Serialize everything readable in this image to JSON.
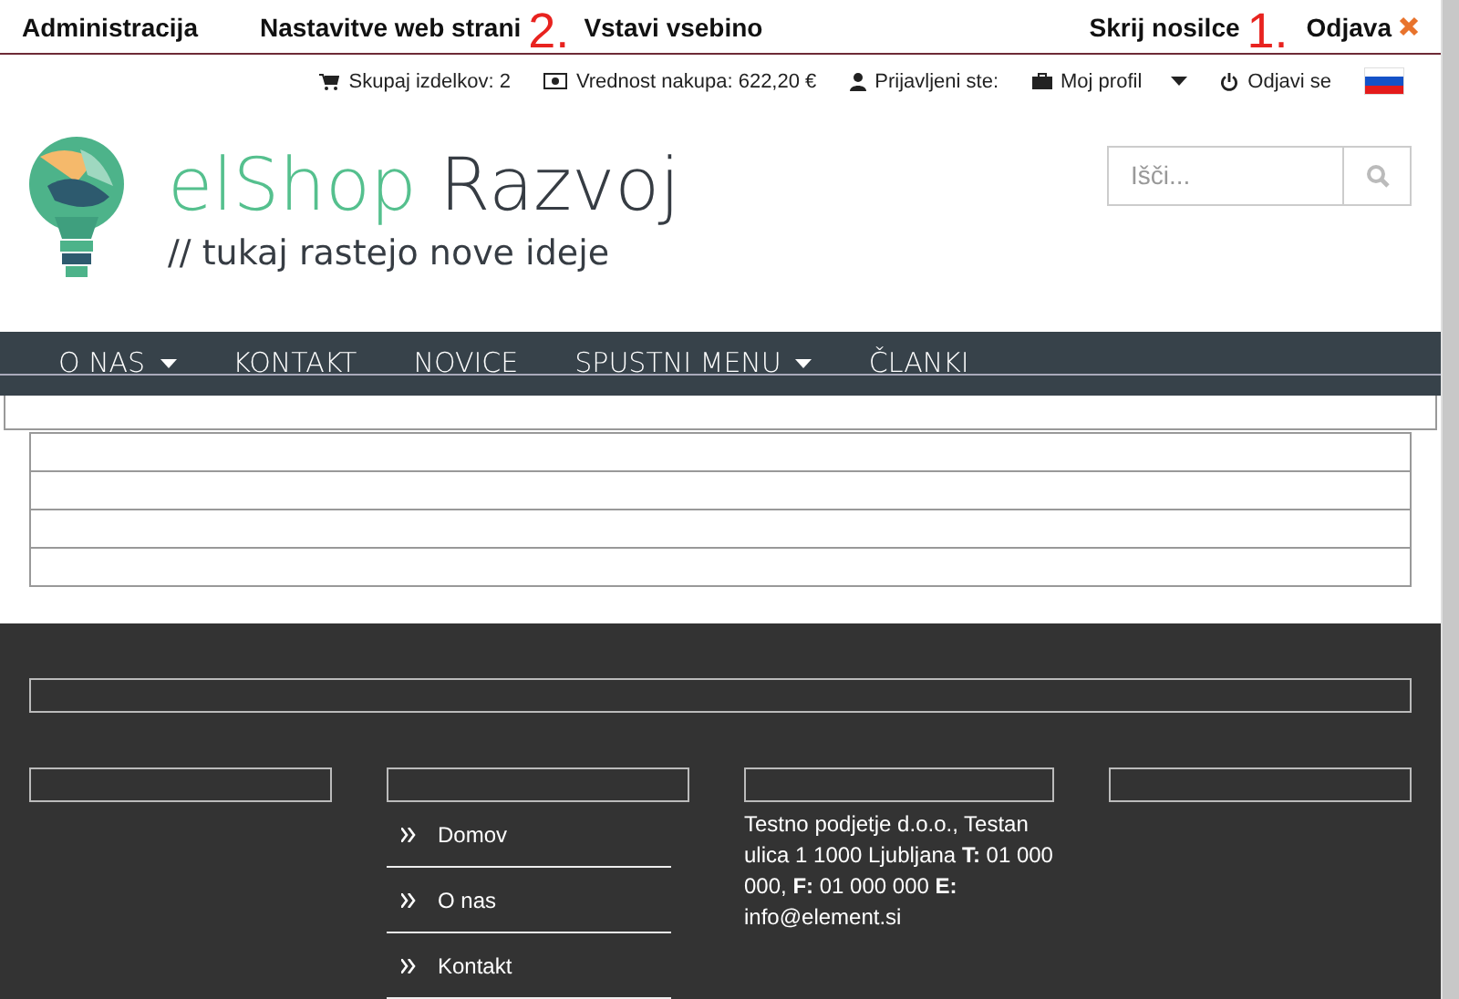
{
  "admin_bar": {
    "left_items": [
      {
        "label": "Administracija"
      },
      {
        "label": "Nastavitve web strani"
      },
      {
        "label": "Vstavi vsebino"
      }
    ],
    "right_items": [
      {
        "label": "Skrij nosilce",
        "kind": "plain"
      },
      {
        "label": "Odjava",
        "kind": "close"
      }
    ]
  },
  "annotations": [
    {
      "label": "2."
    },
    {
      "label": "1."
    }
  ],
  "user_bar": {
    "cart": "Skupaj izdelkov: 2",
    "total": "Vrednost nakupa: 622,20 €",
    "logged_in": "Prijavljeni ste:",
    "profile": "Moj profil",
    "logout": "Odjavi se"
  },
  "logo": {
    "name_first": "elShop",
    "name_second": "Razvoj",
    "tagline": "// tukaj rastejo nove ideje"
  },
  "search": {
    "placeholder": "Išči..."
  },
  "nav": [
    {
      "label": "O NAS",
      "dropdown": true
    },
    {
      "label": "KONTAKT",
      "dropdown": false
    },
    {
      "label": "NOVICE",
      "dropdown": false
    },
    {
      "label": "SPUSTNI MENU",
      "dropdown": true
    },
    {
      "label": "ČLANKI",
      "dropdown": false
    }
  ],
  "footer": {
    "links": [
      {
        "label": "Domov"
      },
      {
        "label": "O nas"
      },
      {
        "label": "Kontakt"
      }
    ],
    "contact": "Testno podjetje d.o.o., Testan ulica 1 1000 Ljubljana **T:** 01 000 000, **F:** 01 000 000 **E:** info@element.si"
  }
}
